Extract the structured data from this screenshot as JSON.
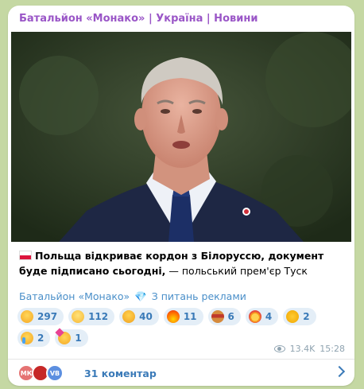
{
  "channel": {
    "title": "Батальйон «Монако» | Україна | Новини"
  },
  "post": {
    "headline": "Польща відкриває кордон з Білоруссю, документ буде підписано сьогодні,",
    "rest": " — польський прем'єр Туск",
    "flag_icon": "poland-flag-icon"
  },
  "source": {
    "name": "Батальйон «Монако»",
    "diamond_icon": "gem-icon",
    "ads_text": "З питань реклами"
  },
  "reactions": [
    {
      "icon": "grinning-face-icon",
      "count": "297"
    },
    {
      "icon": "pleading-face-icon",
      "count": "112"
    },
    {
      "icon": "thinking-face-icon",
      "count": "40"
    },
    {
      "icon": "fire-icon",
      "count": "11"
    },
    {
      "icon": "hotdog-icon",
      "count": "6"
    },
    {
      "icon": "exploding-head-icon",
      "count": "4"
    },
    {
      "icon": "thumbs-up-icon",
      "count": "2"
    },
    {
      "icon": "crying-face-icon",
      "count": "2"
    },
    {
      "icon": "partying-face-icon",
      "count": "1"
    }
  ],
  "meta": {
    "views": "13.4K",
    "time": "15:28"
  },
  "comments": {
    "avatars": [
      "МК",
      "",
      "VB"
    ],
    "label": "31 коментар"
  },
  "colors": {
    "channel_title": "#9a56c7",
    "link": "#3a7ab8",
    "reaction_bg": "#e4eef7"
  }
}
